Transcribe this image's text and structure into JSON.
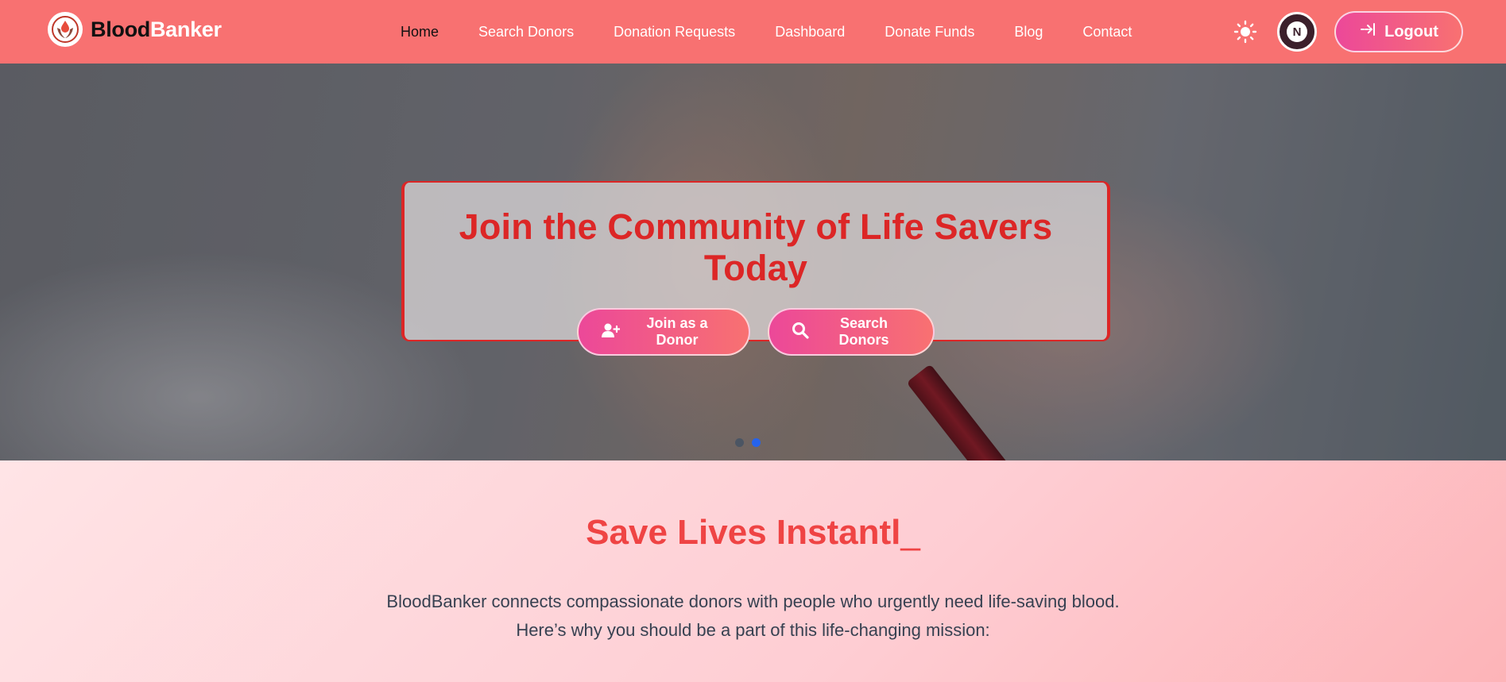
{
  "brand": {
    "name_part1": "Blood",
    "name_part2": "Banker",
    "logo_icon": "blood-drop-hands-icon"
  },
  "nav": {
    "items": [
      {
        "label": "Home",
        "active": true
      },
      {
        "label": "Search Donors",
        "active": false
      },
      {
        "label": "Donation Requests",
        "active": false
      },
      {
        "label": "Dashboard",
        "active": false
      },
      {
        "label": "Donate Funds",
        "active": false
      },
      {
        "label": "Blog",
        "active": false
      },
      {
        "label": "Contact",
        "active": false
      }
    ],
    "theme_icon": "sun-icon",
    "avatar_initial": "N",
    "logout_label": "Logout",
    "logout_icon": "logout-arrow-icon"
  },
  "hero": {
    "title": "Join the Community of Life Savers Today",
    "join_label": "Join as a Donor",
    "join_icon": "user-plus-icon",
    "search_label": "Search Donors",
    "search_icon": "search-icon",
    "slides": 2,
    "active_slide": 2
  },
  "mission": {
    "title": "Save Lives Instantl",
    "cursor": "_",
    "line1": "BloodBanker connects compassionate donors with people who urgently need life-saving blood.",
    "line2": "Here’s why you should be a part of this life-changing mission:"
  },
  "colors": {
    "navbar": "#f87171",
    "accent_red": "#dc2626",
    "gradient_start": "#ec4899",
    "gradient_end": "#f87171",
    "active_dot": "#2563eb"
  }
}
